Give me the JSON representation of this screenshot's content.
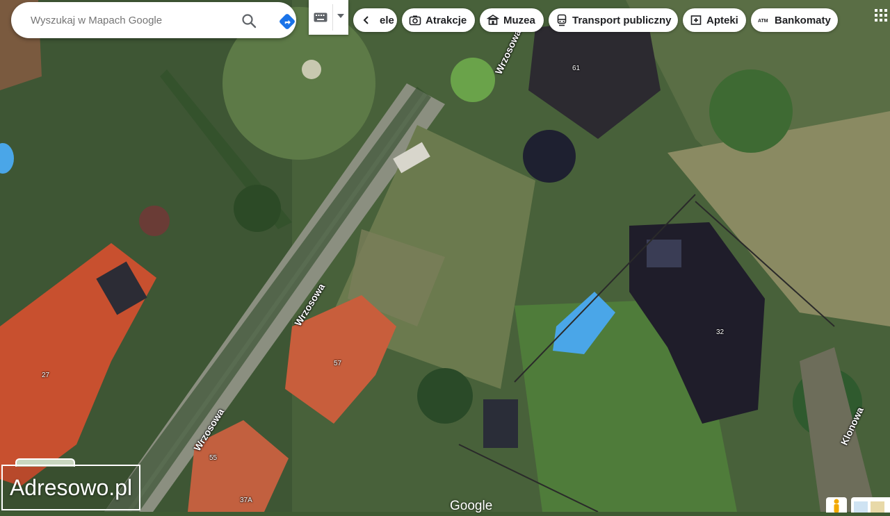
{
  "search": {
    "placeholder": "Wyszukaj w Mapach Google"
  },
  "chips": [
    {
      "label": "ele",
      "icon": "prev-arrow-icon"
    },
    {
      "label": "Atrakcje",
      "icon": "camera-icon"
    },
    {
      "label": "Muzea",
      "icon": "museum-icon"
    },
    {
      "label": "Transport publiczny",
      "icon": "train-icon"
    },
    {
      "label": "Apteki",
      "icon": "pharmacy-icon"
    },
    {
      "label": "Bankomaty",
      "icon": "atm-icon"
    }
  ],
  "streets": [
    "Wrzosowa",
    "Wrzosowa",
    "Wrzosowa",
    "Klonowa"
  ],
  "house_numbers": [
    "61",
    "57",
    "27",
    "32",
    "55",
    "37A"
  ],
  "watermark": "Adresowo.pl",
  "logo": "Google",
  "colors": {
    "directions": "#1a73e8",
    "accent": "#1a73e8"
  }
}
